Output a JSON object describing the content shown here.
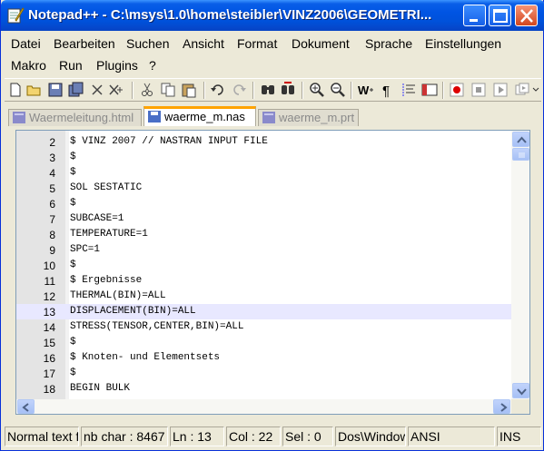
{
  "window": {
    "title": "Notepad++ - C:\\msys\\1.0\\home\\steibler\\VINZ2006\\GEOMETRI..."
  },
  "menu": {
    "row1": [
      "Datei",
      "Bearbeiten",
      "Suchen",
      "Ansicht",
      "Format",
      "Dokument",
      "Sprache",
      "Einstellungen"
    ],
    "row2": [
      "Makro",
      "Run",
      "Plugins",
      "?"
    ]
  },
  "tabs": [
    {
      "label": "Waermeleitung.html",
      "active": false
    },
    {
      "label": "waerme_m.nas",
      "active": true
    },
    {
      "label": "waerme_m.prt",
      "active": false
    }
  ],
  "editor": {
    "current_line": 13,
    "lines": [
      {
        "num": "2",
        "text": "$ VINZ 2007 // NASTRAN INPUT FILE"
      },
      {
        "num": "3",
        "text": "$"
      },
      {
        "num": "4",
        "text": "$"
      },
      {
        "num": "5",
        "text": "SOL SESTATIC"
      },
      {
        "num": "6",
        "text": "$"
      },
      {
        "num": "7",
        "text": "SUBCASE=1"
      },
      {
        "num": "8",
        "text": "TEMPERATURE=1"
      },
      {
        "num": "9",
        "text": "SPC=1"
      },
      {
        "num": "10",
        "text": "$"
      },
      {
        "num": "11",
        "text": "$ Ergebnisse"
      },
      {
        "num": "12",
        "text": "THERMAL(BIN)=ALL"
      },
      {
        "num": "13",
        "text": "DISPLACEMENT(BIN)=ALL"
      },
      {
        "num": "14",
        "text": "STRESS(TENSOR,CENTER,BIN)=ALL"
      },
      {
        "num": "15",
        "text": "$"
      },
      {
        "num": "16",
        "text": "$ Knoten- und Elementsets"
      },
      {
        "num": "17",
        "text": "$"
      },
      {
        "num": "18",
        "text": "BEGIN BULK"
      }
    ]
  },
  "status": {
    "lang": "Normal text f",
    "chars": "nb char : 8467",
    "line": "Ln : 13",
    "col": "Col : 22",
    "sel": "Sel : 0",
    "eol": "Dos\\Window",
    "encoding": "ANSI",
    "blank": "",
    "mode": "INS"
  },
  "colors": {
    "titlebar": "#0054e3",
    "active_tab_accent": "#ffa300",
    "current_line_bg": "#e8e8ff",
    "gutter_bg": "#e4e4e4"
  }
}
